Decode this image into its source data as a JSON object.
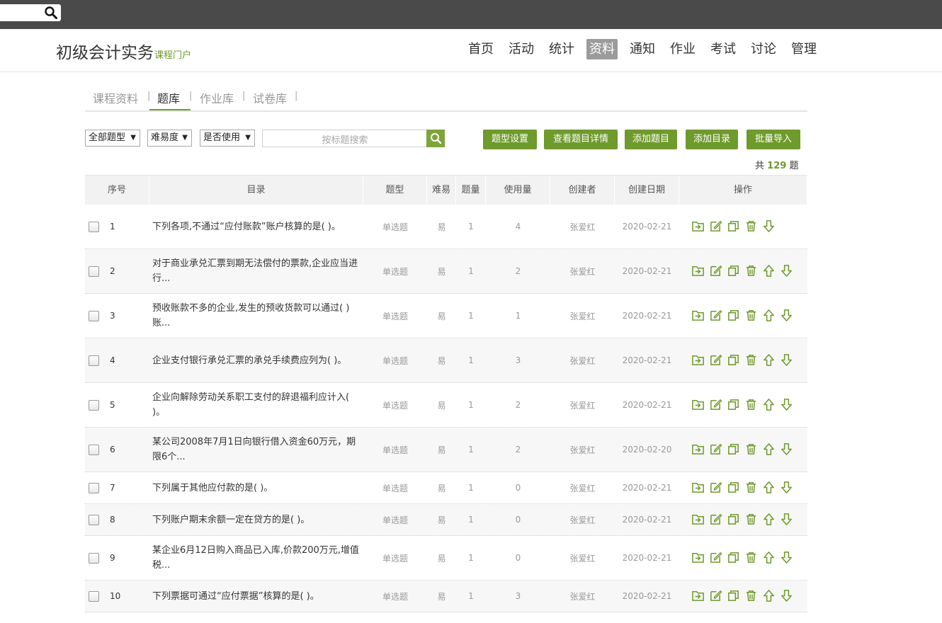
{
  "topbar": {
    "search_icon": "search-icon"
  },
  "header": {
    "brand_title": "初级会计实务",
    "brand_sub": "课程门户",
    "nav": [
      {
        "label": "首页"
      },
      {
        "label": "活动"
      },
      {
        "label": "统计"
      },
      {
        "label": "资料",
        "active": true
      },
      {
        "label": "通知"
      },
      {
        "label": "作业"
      },
      {
        "label": "考试"
      },
      {
        "label": "讨论"
      },
      {
        "label": "管理"
      }
    ]
  },
  "subtabs": [
    {
      "label": "课程资料"
    },
    {
      "label": "题库",
      "active": true
    },
    {
      "label": "作业库"
    },
    {
      "label": "试卷库"
    }
  ],
  "tab_separator": "|",
  "filters": {
    "type": "全部题型",
    "difficulty": "难易度",
    "used": "是否使用",
    "search_placeholder": "按标题搜索"
  },
  "buttons": [
    "题型设置",
    "查看题目详情",
    "添加题目",
    "添加目录",
    "批量导入"
  ],
  "total": {
    "prefix": "共",
    "count": "129",
    "suffix": "题"
  },
  "columns": [
    "序号",
    "目录",
    "题型",
    "难易",
    "题量",
    "使用量",
    "创建者",
    "创建日期",
    "操作"
  ],
  "rows": [
    {
      "no": "1",
      "title": "下列各项,不通过“应付账款”账户核算的是(      )。",
      "type": "单选题",
      "diff": "易",
      "qty": "1",
      "used": "4",
      "creator": "张爱红",
      "date": "2020-02-21"
    },
    {
      "no": "2",
      "title": "对于商业承兑汇票到期无法偿付的票款,企业应当进行...",
      "type": "单选题",
      "diff": "易",
      "qty": "1",
      "used": "2",
      "creator": "张爱红",
      "date": "2020-02-21"
    },
    {
      "no": "3",
      "title": "预收账款不多的企业,发生的预收货款可以通过(      )账...",
      "type": "单选题",
      "diff": "易",
      "qty": "1",
      "used": "1",
      "creator": "张爱红",
      "date": "2020-02-21"
    },
    {
      "no": "4",
      "title": "企业支付银行承兑汇票的承兑手续费应列为(      )。",
      "type": "单选题",
      "diff": "易",
      "qty": "1",
      "used": "3",
      "creator": "张爱红",
      "date": "2020-02-21"
    },
    {
      "no": "5",
      "title": "企业向解除劳动关系职工支付的辞退福利应计入( )。",
      "type": "单选题",
      "diff": "易",
      "qty": "1",
      "used": "2",
      "creator": "张爱红",
      "date": "2020-02-21"
    },
    {
      "no": "6",
      "title": "某公司2008年7月1日向银行借入资金60万元，期限6个...",
      "type": "单选题",
      "diff": "易",
      "qty": "1",
      "used": "2",
      "creator": "张爱红",
      "date": "2020-02-20"
    },
    {
      "no": "7",
      "title": "下列属于其他应付款的是( )。",
      "type": "单选题",
      "diff": "易",
      "qty": "1",
      "used": "0",
      "creator": "张爱红",
      "date": "2020-02-21"
    },
    {
      "no": "8",
      "title": "下列账户期末余额一定在贷方的是( )。",
      "type": "单选题",
      "diff": "易",
      "qty": "1",
      "used": "0",
      "creator": "张爱红",
      "date": "2020-02-21"
    },
    {
      "no": "9",
      "title": "某企业6月12日购入商品已入库,价款200万元,增值税...",
      "type": "单选题",
      "diff": "易",
      "qty": "1",
      "used": "0",
      "creator": "张爱红",
      "date": "2020-02-21"
    },
    {
      "no": "10",
      "title": "下列票据可通过“应付票据”核算的是( )。",
      "type": "单选题",
      "diff": "易",
      "qty": "1",
      "used": "3",
      "creator": "张爱红",
      "date": "2020-02-21"
    }
  ],
  "row_actions": [
    "move-icon",
    "edit-icon",
    "copy-icon",
    "delete-icon",
    "move-up-icon",
    "move-down-icon"
  ],
  "colors": {
    "accent": "#6f9a2c",
    "topbar": "#4a4a4a",
    "nav_active": "#9b9b9b"
  }
}
